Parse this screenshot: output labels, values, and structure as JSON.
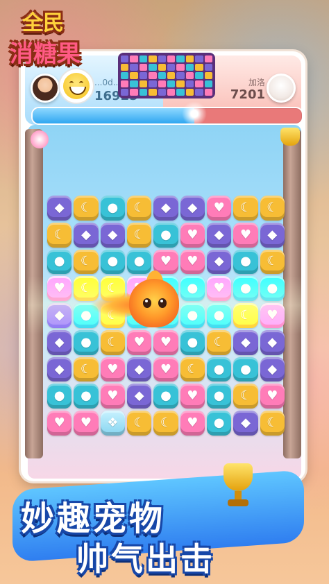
{
  "logo": {
    "line1": "全民",
    "line2": "消糖果"
  },
  "players": {
    "left": {
      "name": "...0d...",
      "score": "16925"
    },
    "right": {
      "name": "加洛",
      "score": "7201"
    }
  },
  "match_progress_left_fraction": 0.6,
  "mini_board_colors": [
    "#7a67d5",
    "#f7bd35",
    "#38c2d7",
    "#ff7cb8"
  ],
  "board": {
    "rows": [
      [
        "purple",
        "yellow",
        "teal",
        "yellow",
        "purple",
        "purple",
        "pink",
        "yellow",
        "yellow"
      ],
      [
        "yellow",
        "purple",
        "purple",
        "yellow",
        "teal",
        "pink",
        "purple",
        "pink",
        "purple"
      ],
      [
        "teal",
        "yellow",
        "teal",
        "teal",
        "pink",
        "pink",
        "purple",
        "teal",
        "yellow"
      ],
      [
        "pink",
        "yellow",
        "yellow",
        "pink",
        "teal",
        "teal",
        "pink",
        "teal",
        "teal"
      ],
      [
        "purple",
        "teal",
        "yellow",
        "teal",
        "teal",
        "teal",
        "teal",
        "yellow",
        "pink"
      ],
      [
        "purple",
        "teal",
        "yellow",
        "pink",
        "pink",
        "teal",
        "yellow",
        "purple",
        "purple"
      ],
      [
        "purple",
        "yellow",
        "pink",
        "purple",
        "pink",
        "yellow",
        "teal",
        "teal",
        "purple"
      ],
      [
        "teal",
        "teal",
        "pink",
        "purple",
        "teal",
        "pink",
        "teal",
        "yellow",
        "pink"
      ],
      [
        "pink",
        "pink",
        "ice",
        "yellow",
        "yellow",
        "pink",
        "teal",
        "purple",
        "yellow"
      ]
    ],
    "glyphs": {
      "purple": "◆",
      "yellow": "☾",
      "teal": "●",
      "pink": "♥",
      "ice": "❖"
    }
  },
  "slogan": {
    "line1": "妙趣宠物",
    "line2": "帅气出击"
  }
}
